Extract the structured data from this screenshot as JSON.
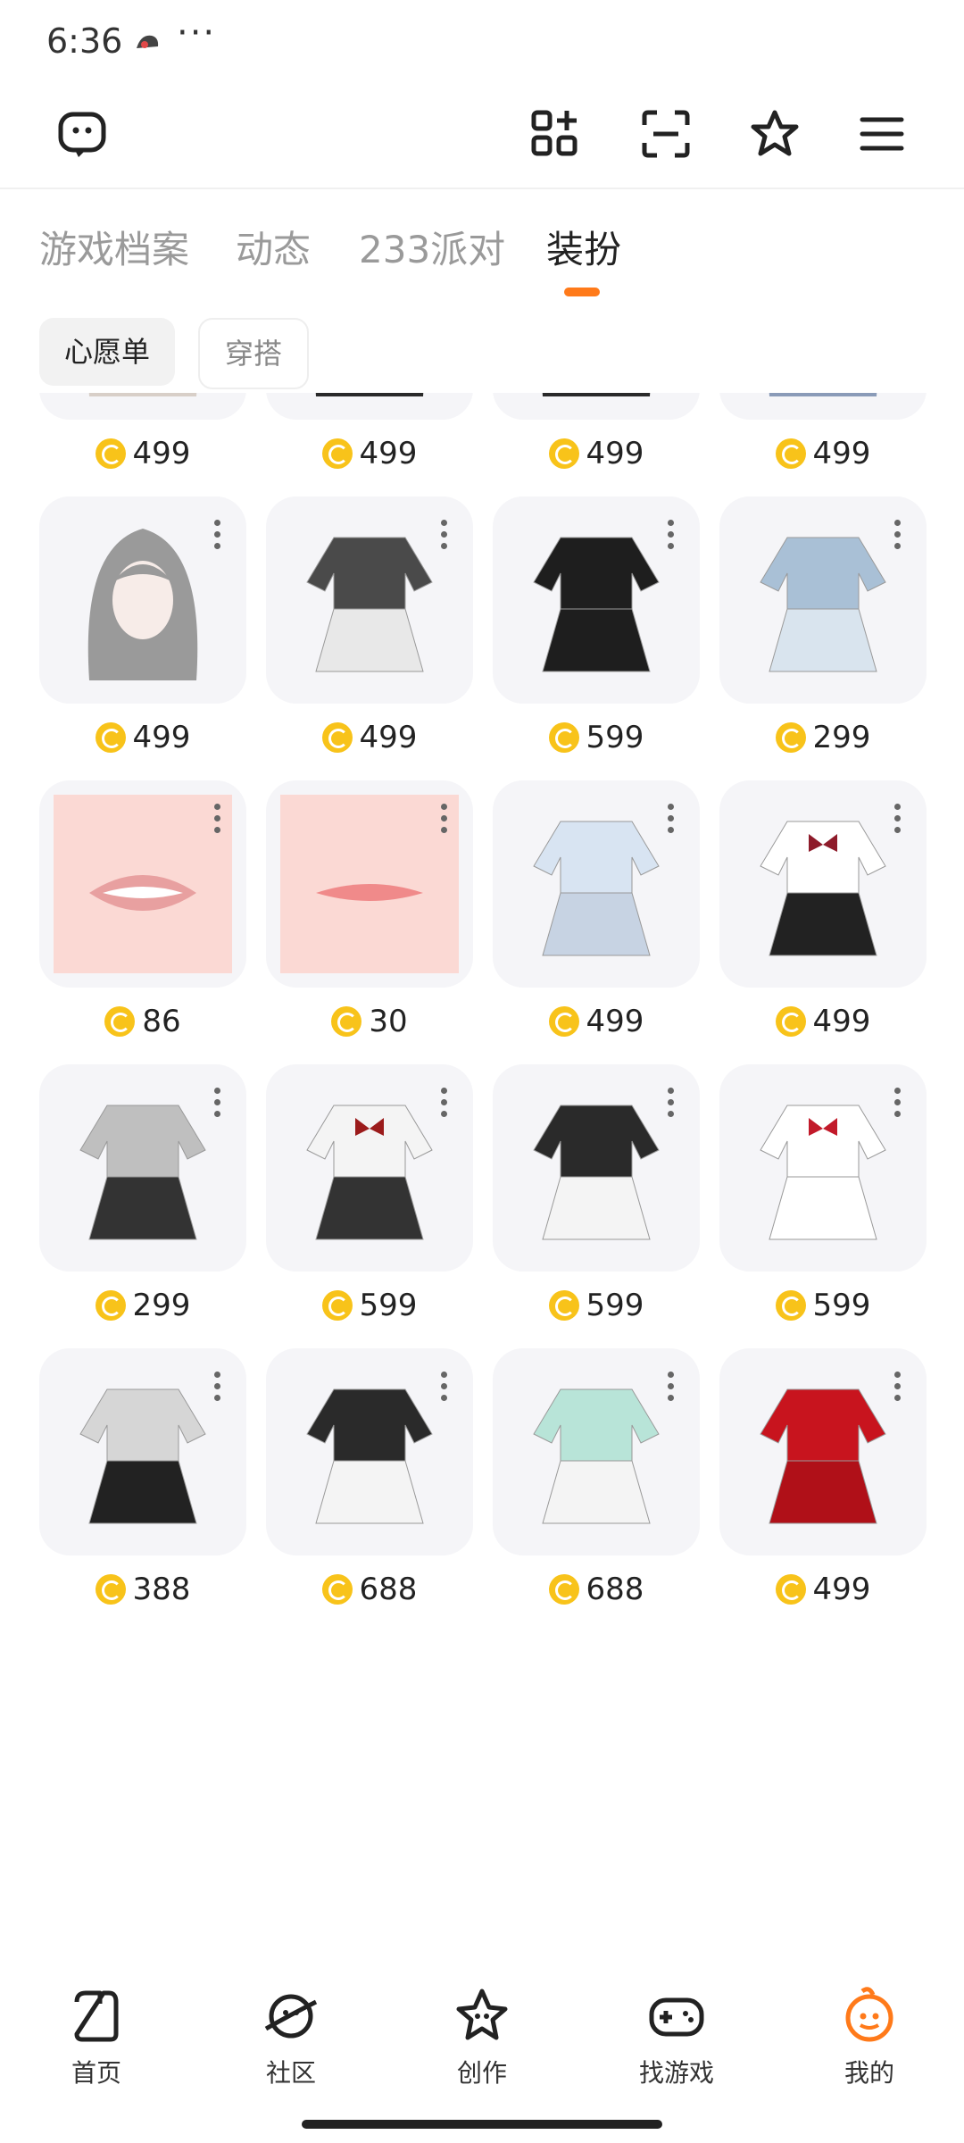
{
  "status_bar": {
    "time": "6:36",
    "dots": "···"
  },
  "toolbar": {
    "icons": [
      "chat-bubble-icon",
      "apps-add-icon",
      "scan-icon",
      "star-badge-icon",
      "menu-icon"
    ]
  },
  "tabs": [
    {
      "label": "游戏档案",
      "active": false
    },
    {
      "label": "动态",
      "active": false
    },
    {
      "label": "233派对",
      "active": false
    },
    {
      "label": "装扮",
      "active": true
    }
  ],
  "filters": [
    {
      "label": "心愿单",
      "active": true
    },
    {
      "label": "穿搭",
      "active": false
    }
  ],
  "items": [
    {
      "type": "hair-light",
      "price": "499"
    },
    {
      "type": "hair-braid",
      "price": "499"
    },
    {
      "type": "hair-dark-partial",
      "price": "599"
    },
    {
      "type": "hair-black-red",
      "price": "499"
    },
    {
      "type": "hair-light",
      "price": "499"
    },
    {
      "type": "hair-black",
      "price": "499"
    },
    {
      "type": "hair-black-pin",
      "price": "499"
    },
    {
      "type": "hair-blue",
      "price": "499"
    },
    {
      "type": "hair-ombre",
      "price": "499"
    },
    {
      "type": "dress-grey",
      "price": "499"
    },
    {
      "type": "sweater-black",
      "price": "599"
    },
    {
      "type": "jacket-denim",
      "price": "299"
    },
    {
      "type": "lips-open",
      "price": "86"
    },
    {
      "type": "lips-closed",
      "price": "30"
    },
    {
      "type": "sailor-blue",
      "price": "499"
    },
    {
      "type": "uniform-red-bow",
      "price": "499"
    },
    {
      "type": "dress-silver",
      "price": "299"
    },
    {
      "type": "sailor-black",
      "price": "599"
    },
    {
      "type": "dress-corset",
      "price": "599"
    },
    {
      "type": "nurse-outfit",
      "price": "599"
    },
    {
      "type": "tee-grey",
      "price": "388"
    },
    {
      "type": "top-bunny-black",
      "price": "688"
    },
    {
      "type": "top-bunny-mint",
      "price": "688"
    },
    {
      "type": "dress-red",
      "price": "499"
    }
  ],
  "bottom_nav": [
    {
      "label": "首页",
      "icon": "home-icon",
      "active": false
    },
    {
      "label": "社区",
      "icon": "planet-icon",
      "active": false
    },
    {
      "label": "创作",
      "icon": "star-create-icon",
      "active": false
    },
    {
      "label": "找游戏",
      "icon": "gamepad-icon",
      "active": false
    },
    {
      "label": "我的",
      "icon": "profile-icon",
      "active": true
    }
  ],
  "colors": {
    "accent": "#ff7a1a",
    "coin": "#f8c31a",
    "card_bg": "#f5f5f8"
  }
}
